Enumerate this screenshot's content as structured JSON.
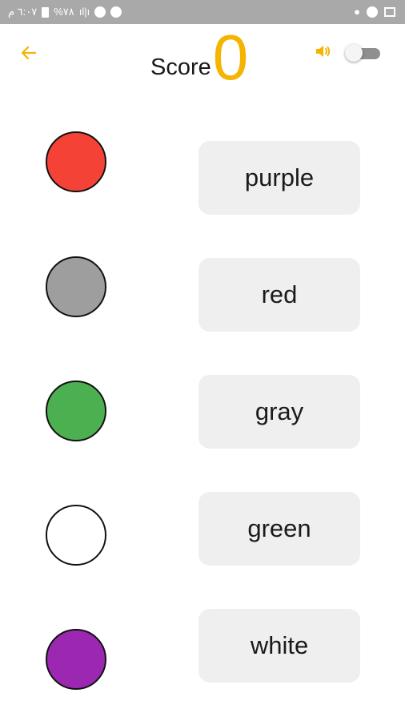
{
  "status_bar": {
    "time": "٦:٠٧ م",
    "battery": "%٧٨",
    "signal": "ıl|ı"
  },
  "header": {
    "score_label": "Score",
    "score_value": "0",
    "accent_color": "#f4b400"
  },
  "circles": [
    {
      "color_name": "red",
      "color": "#f44336"
    },
    {
      "color_name": "gray",
      "color": "#9e9e9e"
    },
    {
      "color_name": "green",
      "color": "#4caf50"
    },
    {
      "color_name": "white",
      "color": "#ffffff"
    },
    {
      "color_name": "purple",
      "color": "#9c27b0"
    }
  ],
  "words": [
    {
      "label": "purple"
    },
    {
      "label": "red"
    },
    {
      "label": "gray"
    },
    {
      "label": "green"
    },
    {
      "label": "white"
    }
  ]
}
